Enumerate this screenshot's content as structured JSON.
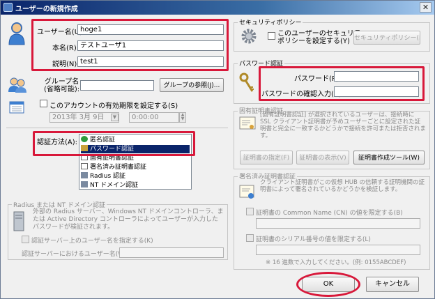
{
  "window": {
    "title": "ユーザーの新規作成",
    "close_glyph": "✕"
  },
  "user": {
    "username_label": "ユーザー名(U):",
    "username_value": "hoge1",
    "realname_label": "本名(R):",
    "realname_value": "テストユーザ1",
    "description_label": "説明(N):",
    "description_value": "test1"
  },
  "group": {
    "label_line1": "グループ名",
    "label_line2": "(省略可能):",
    "value": "",
    "browse_button": "グループの参照(J)..."
  },
  "expiry": {
    "checkbox_label": "このアカウントの有効期限を設定する(S)",
    "date_value": "2013年 3月 9日",
    "time_value": "0:00:00"
  },
  "auth": {
    "label": "認証方法(A):",
    "options": [
      "匿名認証",
      "パスワード認証",
      "固有証明書認証",
      "署名済み証明書認証",
      "Radius 認証",
      "NT ドメイン認証"
    ],
    "selected_index": 1
  },
  "radius": {
    "group_title": "Radius または NT ドメイン認証",
    "description": "外部の Radius サーバー、Windows NT ドメインコントローラ、または Active Directory コントローラによってユーザーが入力したパスワードが検証されます。",
    "checkbox_label": "認証サーバー上のユーザー名を指定する(K)",
    "username_label": "認証サーバーにおけるユーザー名(W):",
    "username_value": ""
  },
  "security": {
    "group_title": "セキュリティポリシー",
    "checkbox_label_line1": "このユーザーのセキュリティ",
    "checkbox_label_line2": "ポリシーを設定する(Y)",
    "policy_button": "セキュリティポリシー(M)"
  },
  "password": {
    "group_title": "パスワード認証",
    "password_label": "パスワード(P):",
    "password_value": "",
    "confirm_label": "パスワードの確認入力(C):",
    "confirm_value": ""
  },
  "cert": {
    "group_title": "固有証明書認証",
    "description": "[固有証明書認証] が選択されているユーザーは、接続時に SSL クライアント証明書が予めユーザーごとに設定された証明書と完全に一致するかどうかで接続を許可または拒否されます。",
    "specify_button": "証明書の指定(F)",
    "view_button": "証明書の表示(V)",
    "create_tool_button": "証明書作成ツール(W)"
  },
  "signed": {
    "group_title": "署名済み証明書認証",
    "description": "クライアント証明書がこの仮想 HUB の信頼する証明機関の証明書によって署名されているかどうかを検証します。",
    "cn_checkbox_label": "証明書の Common Name (CN) の値を限定する(B)",
    "cn_value": "",
    "serial_checkbox_label": "証明書のシリアル番号の値を限定する(L)",
    "serial_value": "",
    "hint": "※ 16 進数で入力してください。(例: 0155ABCDEF)"
  },
  "footer": {
    "ok_button": "OK",
    "cancel_button": "キャンセル"
  },
  "colors": {
    "highlight": "#d8183a",
    "selection": "#0a246a",
    "title_bar": "#0a246a"
  }
}
